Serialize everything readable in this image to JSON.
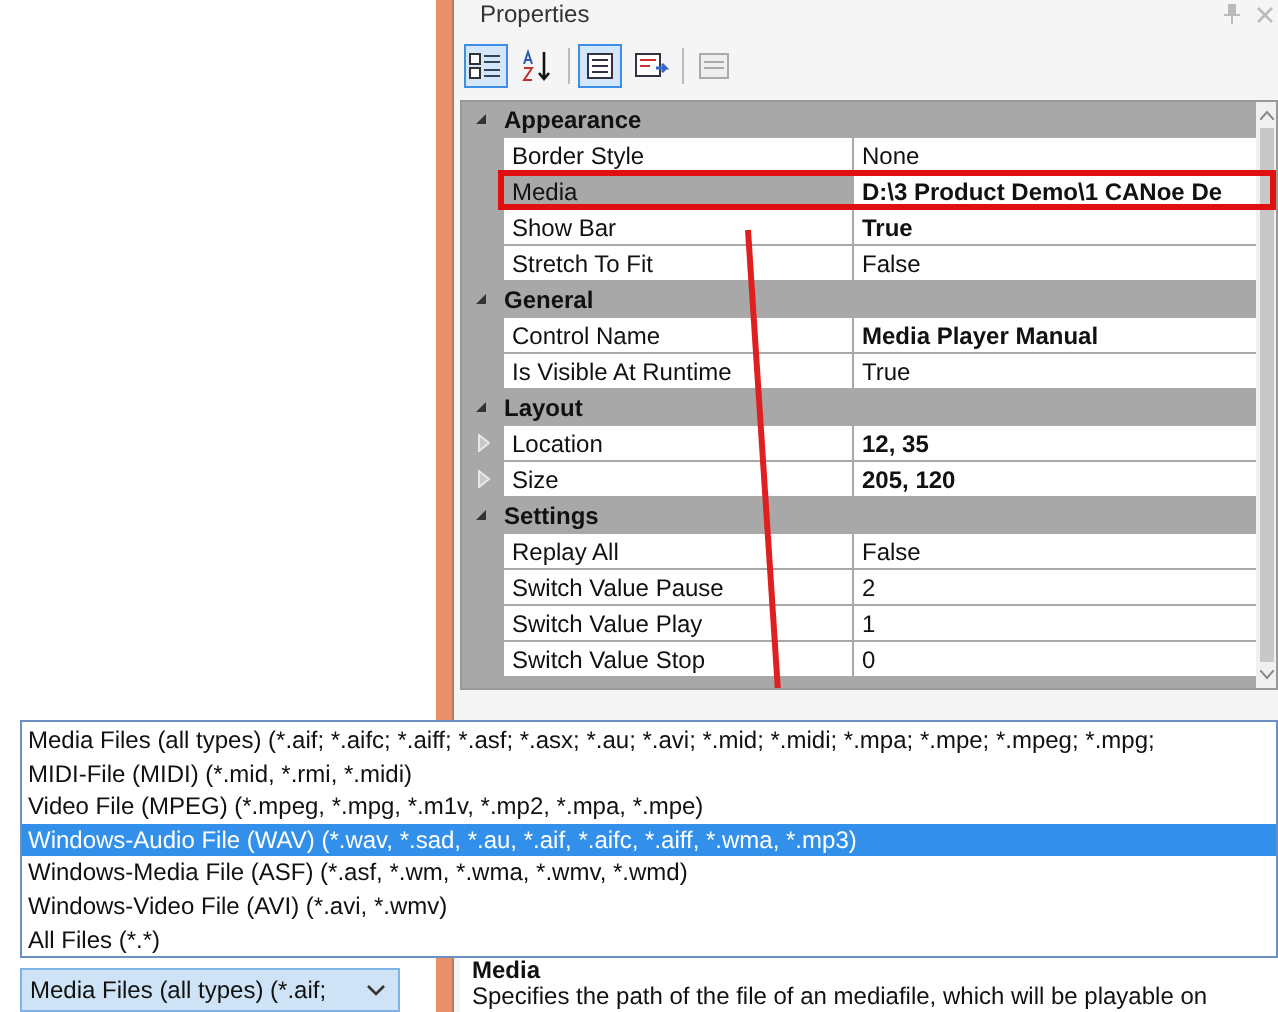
{
  "panel": {
    "title": "Properties"
  },
  "toolbar": [
    {
      "kind": "categorized",
      "selected": true
    },
    {
      "kind": "alphabetical",
      "selected": false
    },
    {
      "kind": "properties",
      "selected": true
    },
    {
      "kind": "events",
      "selected": false
    },
    {
      "kind": "pages",
      "selected": false
    }
  ],
  "categories": [
    {
      "name": "Appearance",
      "expanded": true,
      "properties": [
        {
          "name": "Border Style",
          "value": "None",
          "modified": false,
          "highlighted": false
        },
        {
          "name": "Media",
          "value": "D:\\3 Product Demo\\1 CANoe De",
          "modified": true,
          "highlighted": true
        },
        {
          "name": "Show Bar",
          "value": "True",
          "modified": true,
          "highlighted": false
        },
        {
          "name": "Stretch To Fit",
          "value": "False",
          "modified": false,
          "highlighted": false
        }
      ]
    },
    {
      "name": "General",
      "expanded": true,
      "properties": [
        {
          "name": "Control Name",
          "value": "Media Player Manual",
          "modified": true,
          "highlighted": false
        },
        {
          "name": "Is Visible At Runtime",
          "value": "True",
          "modified": false,
          "highlighted": false
        }
      ]
    },
    {
      "name": "Layout",
      "expanded": true,
      "properties": [
        {
          "name": "Location",
          "value": "12, 35",
          "modified": true,
          "highlighted": false,
          "expandable": true
        },
        {
          "name": "Size",
          "value": "205, 120",
          "modified": true,
          "highlighted": false,
          "expandable": true
        }
      ]
    },
    {
      "name": "Settings",
      "expanded": true,
      "properties": [
        {
          "name": "Replay All",
          "value": "False",
          "modified": false,
          "highlighted": false
        },
        {
          "name": "Switch Value Pause",
          "value": "2",
          "modified": false,
          "highlighted": false
        },
        {
          "name": "Switch Value Play",
          "value": "1",
          "modified": false,
          "highlighted": false
        },
        {
          "name": "Switch Value Stop",
          "value": "0",
          "modified": false,
          "highlighted": false
        }
      ]
    }
  ],
  "file_type_list": [
    {
      "label": "Media Files (all types) (*.aif; *.aifc; *.aiff; *.asf; *.asx; *.au; *.avi; *.mid; *.midi; *.mpa; *.mpe; *.mpeg; *.mpg;",
      "selected": false
    },
    {
      "label": "MIDI-File (MIDI) (*.mid, *.rmi, *.midi)",
      "selected": false
    },
    {
      "label": "Video File (MPEG) (*.mpeg, *.mpg, *.m1v, *.mp2, *.mpa, *.mpe)",
      "selected": false
    },
    {
      "label": "Windows-Audio File (WAV) (*.wav, *.sad, *.au, *.aif, *.aifc, *.aiff, *.wma, *.mp3)",
      "selected": true
    },
    {
      "label": "Windows-Media File (ASF) (*.asf, *.wm, *.wma, *.wmv, *.wmd)",
      "selected": false
    },
    {
      "label": "Windows-Video File (AVI) (*.avi, *.wmv)",
      "selected": false
    },
    {
      "label": "All Files (*.*)",
      "selected": false
    }
  ],
  "file_type_combo": {
    "value": "Media Files (all types) (*.aif;"
  },
  "description": {
    "title": "Media",
    "text": "Specifies the path of the file of an mediafile, which will be playable on"
  }
}
